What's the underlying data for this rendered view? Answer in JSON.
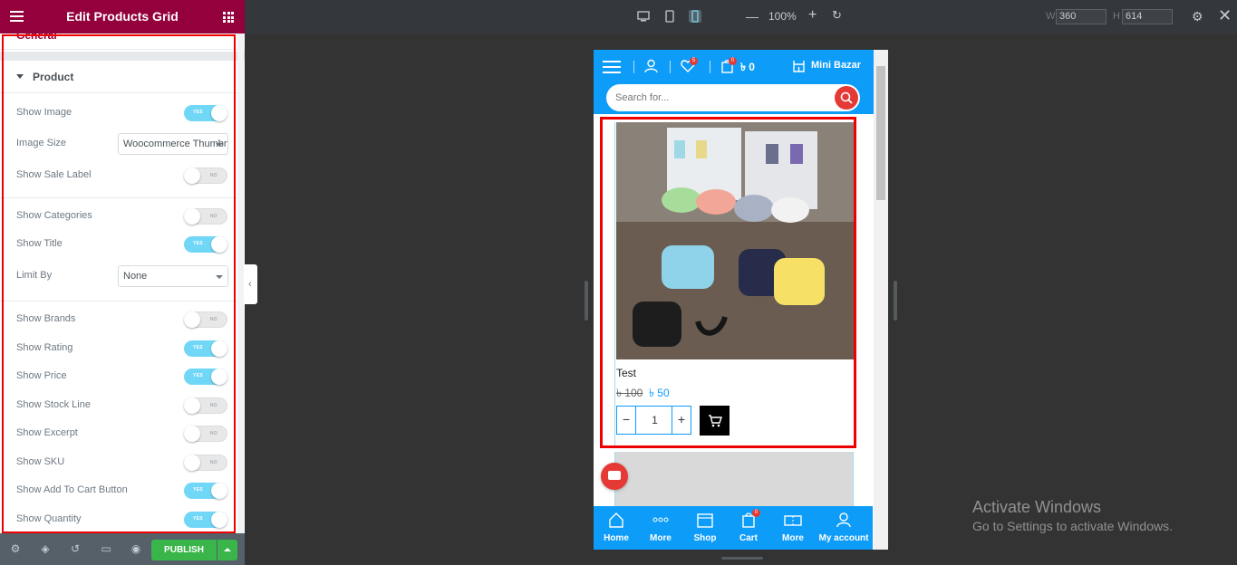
{
  "panel": {
    "title": "Edit Products Grid",
    "section_general": "General",
    "section_product": "Product",
    "toggle_on_text": "YES",
    "toggle_off_text": "NO",
    "controls": [
      {
        "label": "Show Image",
        "type": "toggle",
        "value": true
      },
      {
        "label": "Image Size",
        "type": "select",
        "value": "Woocommerce Thumbnail"
      },
      {
        "label": "Show Sale Label",
        "type": "toggle",
        "value": false
      },
      {
        "label": "Show Categories",
        "type": "toggle",
        "value": false
      },
      {
        "label": "Show Title",
        "type": "toggle",
        "value": true
      },
      {
        "label": "Limit By",
        "type": "select",
        "value": "None"
      },
      {
        "label": "Show Brands",
        "type": "toggle",
        "value": false
      },
      {
        "label": "Show Rating",
        "type": "toggle",
        "value": true
      },
      {
        "label": "Show Price",
        "type": "toggle",
        "value": true
      },
      {
        "label": "Show Stock Line",
        "type": "toggle",
        "value": false
      },
      {
        "label": "Show Excerpt",
        "type": "toggle",
        "value": false
      },
      {
        "label": "Show SKU",
        "type": "toggle",
        "value": false
      },
      {
        "label": "Show Add To Cart Button",
        "type": "toggle",
        "value": true
      },
      {
        "label": "Show Quantity",
        "type": "toggle",
        "value": true
      }
    ],
    "footer": {
      "publish": "PUBLISH"
    }
  },
  "topbar": {
    "zoom": "100%",
    "width_label": "W",
    "width_value": "360",
    "height_label": "H",
    "height_value": "614"
  },
  "site": {
    "wishlist_count": "5",
    "cart_count": "0",
    "cart_total": "৳ 0",
    "store_name": "Mini Bazar",
    "search_placeholder": "Search for...",
    "product": {
      "title": "Test",
      "old_price": "৳ 100",
      "new_price": "৳ 50",
      "quantity": "1"
    },
    "bottom_nav": [
      {
        "label": "Home",
        "icon": "home-icon"
      },
      {
        "label": "More",
        "icon": "dots-icon"
      },
      {
        "label": "Shop",
        "icon": "shop-icon"
      },
      {
        "label": "Cart",
        "icon": "cart-icon"
      },
      {
        "label": "More",
        "icon": "ticket-icon"
      },
      {
        "label": "My account",
        "icon": "user-icon"
      }
    ],
    "bottom_cart_badge": "0"
  },
  "watermark": {
    "line1": "Activate Windows",
    "line2": "Go to Settings to activate Windows."
  },
  "colors": {
    "panel_header": "#93003c",
    "site_blue": "#0d9cf8",
    "toggle_on": "#71d7f7",
    "publish_green": "#39b54a",
    "highlight_red": "#e00000"
  }
}
